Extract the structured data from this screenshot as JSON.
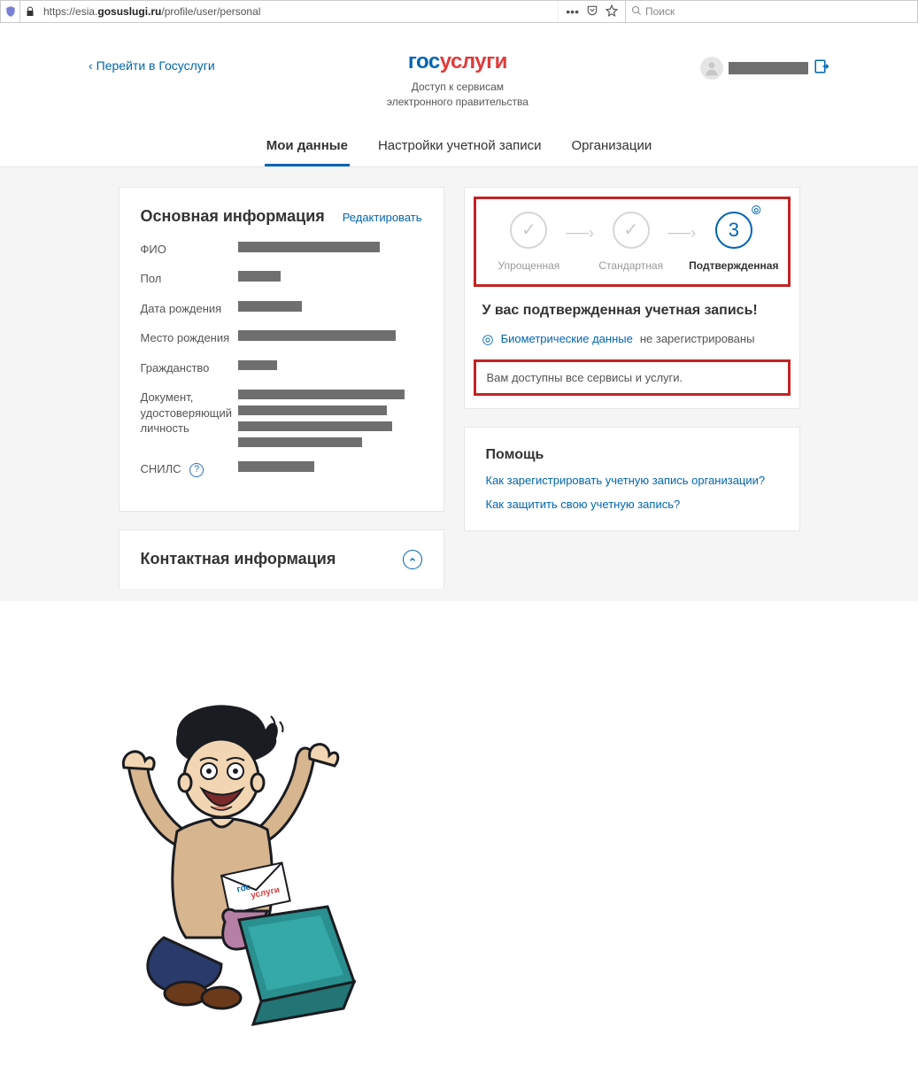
{
  "browser": {
    "url_prefix": "https://esia.",
    "url_bold": "gosuslugi.ru",
    "url_suffix": "/profile/user/personal",
    "search_placeholder": "Поиск"
  },
  "header": {
    "back_label": "Перейти в Госуслуги",
    "logo_part1": "гос",
    "logo_part2": "услуги",
    "subtitle_line1": "Доступ к сервисам",
    "subtitle_line2": "электронного правительства"
  },
  "tabs": {
    "t1": "Мои данные",
    "t2": "Настройки учетной записи",
    "t3": "Организации"
  },
  "main_info": {
    "title": "Основная информация",
    "edit": "Редактировать",
    "labels": {
      "fio": "ФИО",
      "pol": "Пол",
      "dob": "Дата рождения",
      "pob": "Место рождения",
      "citizenship": "Гражданство",
      "doc": "Документ, удостоверяющий личность",
      "snils": "СНИЛС"
    }
  },
  "contact": {
    "title": "Контактная информация"
  },
  "status": {
    "step1": "Упрощенная",
    "step2": "Стандартная",
    "step3": "Подтвержденная",
    "step3_num": "3",
    "headline": "У вас подтвержденная учетная запись!",
    "bio_link": "Биометрические данные",
    "bio_end": "не зарегистрированы",
    "access_text": "Вам доступны все сервисы и услуги."
  },
  "help": {
    "title": "Помощь",
    "link1": "Как зарегистрировать учетную запись организации?",
    "link2": "Как защитить свою учетную запись?"
  },
  "illus": {
    "env_text1": "гос",
    "env_text2": "услуги"
  }
}
